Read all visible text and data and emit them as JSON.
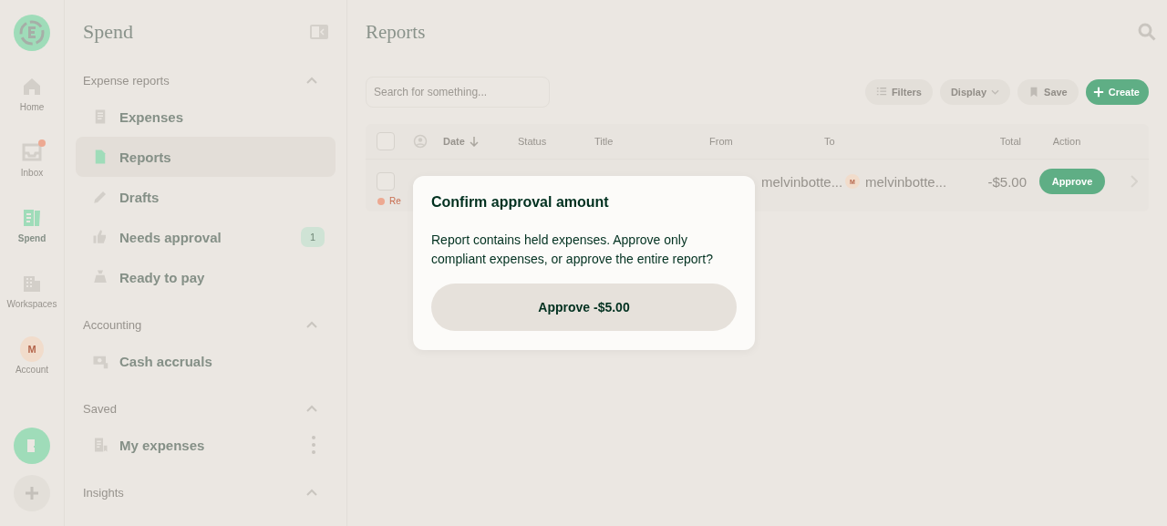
{
  "rail": {
    "items": [
      {
        "label": "Home",
        "kind": "icon",
        "selected": false,
        "dot": false
      },
      {
        "label": "Inbox",
        "kind": "icon",
        "selected": false,
        "dot": true
      },
      {
        "label": "Spend",
        "kind": "icon",
        "selected": true,
        "dot": false
      },
      {
        "label": "Workspaces",
        "kind": "icon",
        "selected": false,
        "dot": false
      },
      {
        "label": "Account",
        "kind": "avatar",
        "initial": "M",
        "selected": false,
        "dot": false
      }
    ]
  },
  "sidebar": {
    "title": "Spend",
    "sections": [
      {
        "title": "Expense reports",
        "expanded": true,
        "items": [
          {
            "label": "Expenses",
            "selected": false
          },
          {
            "label": "Reports",
            "selected": true
          },
          {
            "label": "Drafts",
            "selected": false
          },
          {
            "label": "Needs approval",
            "selected": false,
            "badge": "1"
          },
          {
            "label": "Ready to pay",
            "selected": false
          }
        ]
      },
      {
        "title": "Accounting",
        "expanded": true,
        "items": [
          {
            "label": "Cash accruals",
            "selected": false
          }
        ]
      },
      {
        "title": "Saved",
        "expanded": true,
        "items": [
          {
            "label": "My expenses",
            "selected": false,
            "more": true
          }
        ]
      },
      {
        "title": "Insights",
        "expanded": true
      }
    ]
  },
  "main": {
    "title": "Reports",
    "search": {
      "placeholder": "Search for something..."
    },
    "toolbar": [
      {
        "label": "Filters",
        "kind": "button"
      },
      {
        "label": "Display",
        "kind": "dropdown"
      },
      {
        "label": "Save",
        "kind": "button"
      },
      {
        "label": "Create",
        "kind": "primary"
      }
    ],
    "table": {
      "all_checked": false,
      "columns": [
        "Date",
        "Status",
        "Title",
        "From",
        "To",
        "Total",
        "Action"
      ],
      "rows": [
        {
          "checked": false,
          "from": "melvinbotte...",
          "to": "melvinbotte...",
          "to_avatar": "M",
          "total": "-$5.00",
          "action": "Approve",
          "note": "Re"
        }
      ]
    }
  },
  "dialog": {
    "title": "Confirm approval amount",
    "message": "Report contains held expenses. Approve only compliant expenses, or approve the entire report?",
    "button": "Approve -$5.00"
  }
}
